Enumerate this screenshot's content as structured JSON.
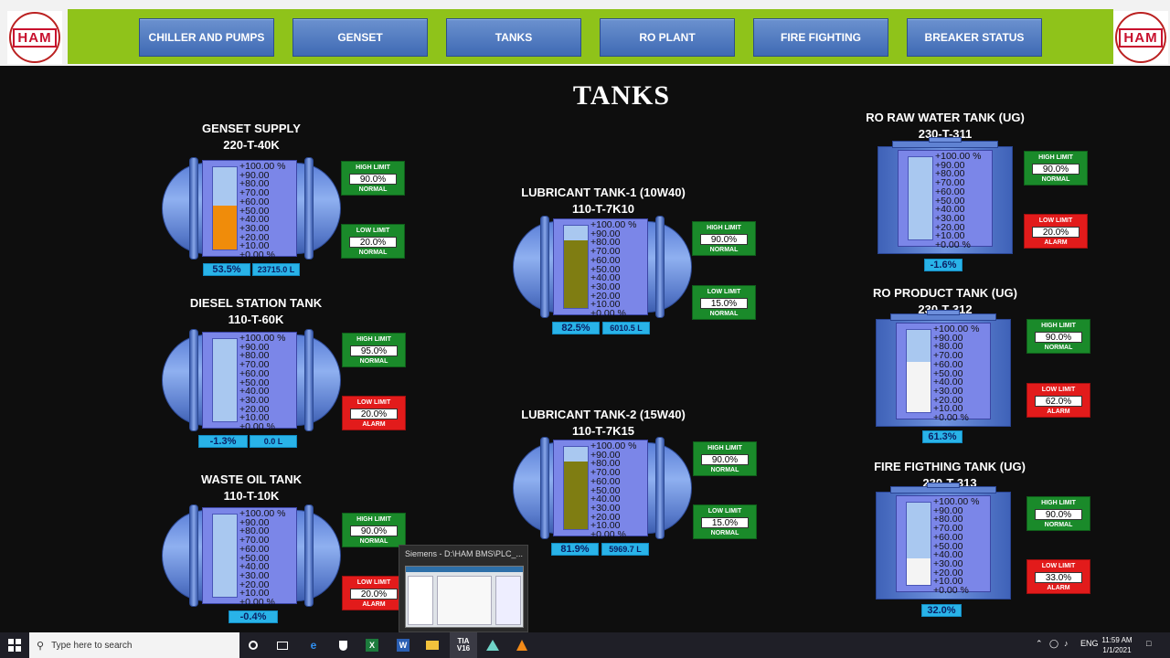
{
  "nav": {
    "logo_text": "HAM",
    "buttons": [
      "CHILLER AND PUMPS",
      "GENSET",
      "TANKS",
      "RO PLANT",
      "FIRE FIGHTING",
      "BREAKER STATUS"
    ]
  },
  "page_title": "TANKS",
  "scale_ticks": [
    "+100.00 %",
    "+90.00",
    "+80.00",
    "+70.00",
    "+60.00",
    "+50.00",
    "+40.00",
    "+30.00",
    "+20.00",
    "+10.00",
    "+0.00 %"
  ],
  "tanks": [
    {
      "name": "GENSET SUPPLY",
      "tag": "220-T-40K",
      "level_pct": "53.5%",
      "volume": "23715.0 L",
      "high": {
        "label": "HIGH LIMIT",
        "value": "90.0%",
        "status": "NORMAL"
      },
      "low": {
        "label": "LOW LIMIT",
        "value": "20.0%",
        "status": "NORMAL"
      }
    },
    {
      "name": "DIESEL STATION TANK",
      "tag": "110-T-60K",
      "level_pct": "-1.3%",
      "volume": "0.0 L",
      "high": {
        "label": "HIGH LIMIT",
        "value": "95.0%",
        "status": "NORMAL"
      },
      "low": {
        "label": "LOW LIMIT",
        "value": "20.0%",
        "status": "ALARM"
      }
    },
    {
      "name": "WASTE OIL TANK",
      "tag": "110-T-10K",
      "level_pct": "-0.4%",
      "high": {
        "label": "HIGH LIMIT",
        "value": "90.0%",
        "status": "NORMAL"
      },
      "low": {
        "label": "LOW LIMIT",
        "value": "20.0%",
        "status": "ALARM"
      }
    },
    {
      "name": "LUBRICANT TANK-1 (10W40)",
      "tag": "110-T-7K10",
      "level_pct": "82.5%",
      "volume": "6010.5 L",
      "high": {
        "label": "HIGH LIMIT",
        "value": "90.0%",
        "status": "NORMAL"
      },
      "low": {
        "label": "LOW LIMIT",
        "value": "15.0%",
        "status": "NORMAL"
      }
    },
    {
      "name": "LUBRICANT TANK-2 (15W40)",
      "tag": "110-T-7K15",
      "level_pct": "81.9%",
      "volume": "5969.7 L",
      "high": {
        "label": "HIGH LIMIT",
        "value": "90.0%",
        "status": "NORMAL"
      },
      "low": {
        "label": "LOW LIMIT",
        "value": "15.0%",
        "status": "NORMAL"
      }
    },
    {
      "name": "RO RAW WATER TANK (UG)",
      "tag": "230-T-311",
      "level_pct": "-1.6%",
      "high": {
        "label": "HIGH LIMIT",
        "value": "90.0%",
        "status": "NORMAL"
      },
      "low": {
        "label": "LOW LIMIT",
        "value": "20.0%",
        "status": "ALARM"
      }
    },
    {
      "name": "RO PRODUCT TANK (UG)",
      "tag": "230-T-312",
      "level_pct": "61.3%",
      "high": {
        "label": "HIGH LIMIT",
        "value": "90.0%",
        "status": "NORMAL"
      },
      "low": {
        "label": "LOW LIMIT",
        "value": "62.0%",
        "status": "ALARM"
      }
    },
    {
      "name": "FIRE FIGTHING TANK (UG)",
      "tag": "230-T-313",
      "level_pct": "32.0%",
      "high": {
        "label": "HIGH LIMIT",
        "value": "90.0%",
        "status": "NORMAL"
      },
      "low": {
        "label": "LOW LIMIT",
        "value": "33.0%",
        "status": "ALARM"
      }
    }
  ],
  "levels": [
    0.535,
    0.0,
    0.0,
    0.825,
    0.819,
    0.0,
    0.613,
    0.32
  ],
  "fill_colors": [
    "#f08c0a",
    "#a9c8f0",
    "#c8c8f0",
    "#7f7d12",
    "#7f7d12",
    "#a9c8f0",
    "#f4f4f4",
    "#f4f4f4"
  ],
  "popup": {
    "title": "Siemens - D:\\HAM BMS\\PLC_..."
  },
  "taskbar": {
    "search_placeholder": "Type here to search",
    "lang": "ENG",
    "time": "11:59 AM",
    "date": "1/1/2021"
  }
}
